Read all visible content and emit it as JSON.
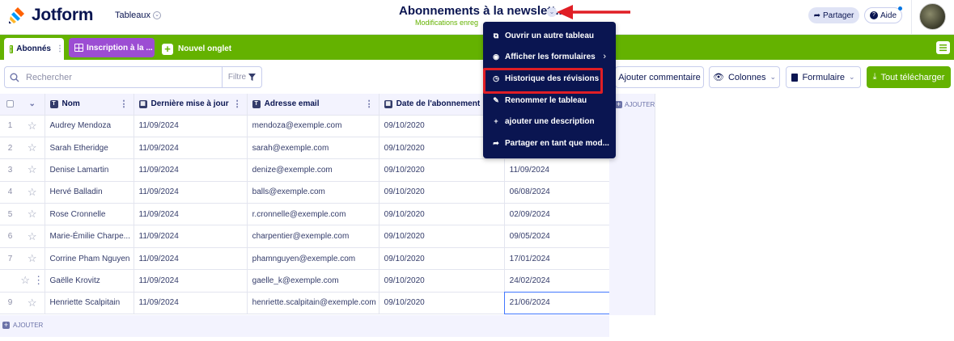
{
  "app": {
    "logo_text": "Jotform",
    "tables_menu": "Tableaux",
    "title": "Abonnements à la newslett...",
    "saved_status": "Modifications enreg",
    "share_label": "Partager",
    "help_label": "Aide"
  },
  "tabs": [
    {
      "label": "Abonnés"
    },
    {
      "label": "Inscription à la ..."
    },
    {
      "label": "Nouvel onglet"
    }
  ],
  "toolbar": {
    "search_placeholder": "Rechercher",
    "filter_label": "Filtre",
    "add_comment": "Ajouter commentaire",
    "columns": "Colonnes",
    "form": "Formulaire",
    "download_all": "Tout télécharger"
  },
  "table": {
    "columns": [
      "Nom",
      "Dernière mise à jour",
      "Adresse email",
      "Date de l'abonnement",
      ""
    ],
    "add_column": "AJOUTER",
    "add_row": "AJOUTER",
    "rows": [
      {
        "idx": "1",
        "nom": "Audrey Mendoza",
        "maj": "11/09/2024",
        "email": "mendoza@exemple.com",
        "date": "09/10/2020",
        "extra": ""
      },
      {
        "idx": "2",
        "nom": "Sarah Etheridge",
        "maj": "11/09/2024",
        "email": "sarah@exemple.com",
        "date": "09/10/2020",
        "extra": ""
      },
      {
        "idx": "3",
        "nom": "Denise Lamartin",
        "maj": "11/09/2024",
        "email": "denize@exemple.com",
        "date": "09/10/2020",
        "extra": "11/09/2024"
      },
      {
        "idx": "4",
        "nom": "Hervé Balladin",
        "maj": "11/09/2024",
        "email": "balls@exemple.com",
        "date": "09/10/2020",
        "extra": "06/08/2024"
      },
      {
        "idx": "5",
        "nom": "Rose Cronnelle",
        "maj": "11/09/2024",
        "email": "r.cronnelle@exemple.com",
        "date": "09/10/2020",
        "extra": "02/09/2024"
      },
      {
        "idx": "6",
        "nom": "Marie-Émilie Charpe...",
        "maj": "11/09/2024",
        "email": "charpentier@exemple.com",
        "date": "09/10/2020",
        "extra": "09/05/2024"
      },
      {
        "idx": "7",
        "nom": "Corrine Pham Nguyen",
        "maj": "11/09/2024",
        "email": "phamnguyen@exemple.com",
        "date": "09/10/2020",
        "extra": "17/01/2024"
      },
      {
        "idx": "",
        "nom": "Gaëlle Krovitz",
        "maj": "11/09/2024",
        "email": "gaelle_k@exemple.com",
        "date": "09/10/2020",
        "extra": "24/02/2024"
      },
      {
        "idx": "9",
        "nom": "Henriette Scalpitain",
        "maj": "11/09/2024",
        "email": "henriette.scalpitain@exemple.com",
        "date": "09/10/2020",
        "extra": "21/06/2024"
      }
    ]
  },
  "dropdown": {
    "items": [
      {
        "label": "Ouvrir un autre tableau",
        "icon": "external-link-icon"
      },
      {
        "label": "Afficher les formulaires",
        "icon": "eye-icon"
      },
      {
        "label": "Historique des révisions",
        "icon": "clock-icon"
      },
      {
        "label": "Renommer le tableau",
        "icon": "pencil-icon"
      },
      {
        "label": "ajouter une description",
        "icon": "plus-icon"
      },
      {
        "label": "Partager en tant que mod...",
        "icon": "share-icon"
      }
    ]
  },
  "colors": {
    "brand_green": "#64b200",
    "navy": "#0a1551",
    "purple_tab": "#9c4dd3",
    "highlight_red": "#e01e25"
  }
}
